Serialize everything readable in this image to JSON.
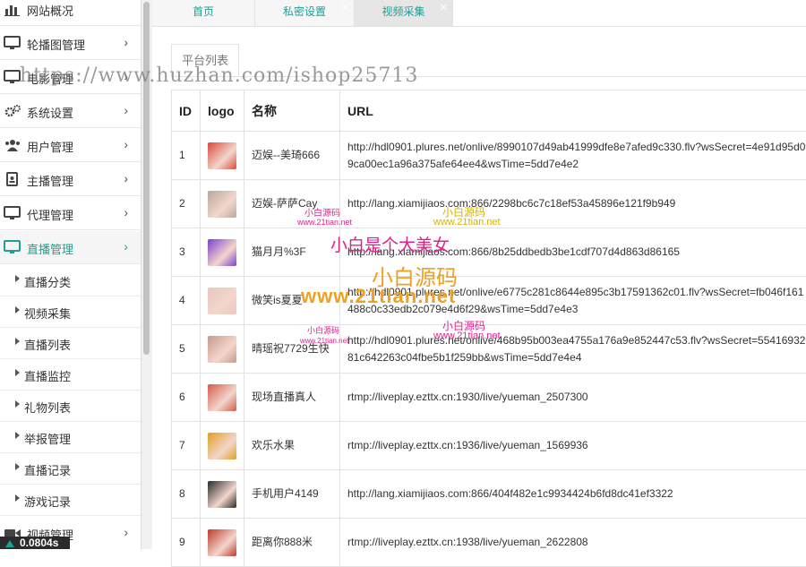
{
  "sidebar": {
    "items": [
      {
        "label": "网站概况",
        "icon": "bar-chart-icon",
        "chevron": false
      },
      {
        "label": "轮播图管理",
        "icon": "monitor-icon",
        "chevron": true
      },
      {
        "label": "电影管理",
        "icon": "monitor-icon",
        "chevron": true
      },
      {
        "label": "系统设置",
        "icon": "gears-icon",
        "chevron": true
      },
      {
        "label": "用户管理",
        "icon": "users-icon",
        "chevron": true
      },
      {
        "label": "主播管理",
        "icon": "id-card-icon",
        "chevron": true
      },
      {
        "label": "代理管理",
        "icon": "monitor-icon",
        "chevron": true
      },
      {
        "label": "直播管理",
        "icon": "monitor-icon",
        "chevron": true,
        "active": true
      }
    ],
    "sub_items": [
      "直播分类",
      "视频采集",
      "直播列表",
      "直播监控",
      "礼物列表",
      "举报管理",
      "直播记录",
      "游戏记录"
    ],
    "bottom_item": {
      "label": "视频管理",
      "icon": "video-camera-icon"
    },
    "chevron": "›",
    "status": "0.0804s",
    "accent": "#1aa094"
  },
  "tabs": [
    {
      "label": "首页",
      "closable": false
    },
    {
      "label": "私密设置",
      "closable": true
    },
    {
      "label": "视频采集",
      "closable": true,
      "active": true
    }
  ],
  "panel": {
    "title": "平台列表"
  },
  "table": {
    "columns": [
      "ID",
      "logo",
      "名称",
      "URL"
    ],
    "rows": [
      {
        "id": "1",
        "name": "迈娱--美琦666",
        "url": "http://hdl0901.plures.net/onlive/8990107d49ab41999dfe8e7afed9c330.flv?wsSecret=4e91d95d09ca00ec1a96a375afe64ee4&wsTime=5dd7e4e2",
        "thumb": "#d84a3c"
      },
      {
        "id": "2",
        "name": "迈娱-萨萨Cay",
        "url": "http://lang.xiamijiaos.com:866/2298bc6c7c18ef53a45896e121f9b949",
        "thumb": "#b9a89a"
      },
      {
        "id": "3",
        "name": "猫月月%3F",
        "url": "http://lang.xiamijiaos.com:866/8b25ddbedb3be1cdf707d4d863d86165",
        "thumb": "#7b3fd0"
      },
      {
        "id": "4",
        "name": "微笑is夏夏",
        "url": "http://hdl0901.plures.net/onlive/e6775c281c8644e895c3b17591362c01.flv?wsSecret=fb046f161488c0c33edb2c079e4d6f29&wsTime=5dd7e4e3",
        "thumb": "#e9c7c0"
      },
      {
        "id": "5",
        "name": "晴瑶祝7729生快",
        "url": "http://hdl0901.plures.net/onlive/468b95b003ea4755a176a9e852447c53.flv?wsSecret=5541693281c642263c04fbe5b1f259bb&wsTime=5dd7e4e4",
        "thumb": "#c89a8a"
      },
      {
        "id": "6",
        "name": "现场直播真人",
        "url": "rtmp://liveplay.ezttx.cn:1930/live/yueman_2507300",
        "thumb": "#d55a4a"
      },
      {
        "id": "7",
        "name": "欢乐水果",
        "url": "rtmp://liveplay.ezttx.cn:1936/live/yueman_1569936",
        "thumb": "#e0a020"
      },
      {
        "id": "8",
        "name": "手机用户4149",
        "url": "http://lang.xiamijiaos.com:866/404f482e1c9934424b6fd8dc41ef3322",
        "thumb": "#2a2a2a"
      },
      {
        "id": "9",
        "name": "距离你888米",
        "url": "rtmp://liveplay.ezttx.cn:1938/live/yueman_2622808",
        "thumb": "#c0392b"
      }
    ]
  },
  "watermarks": {
    "url_banner": "https://www.huzhan.com/ishop25713",
    "small_source": "小白源码",
    "small_domain": "www.21tian.net",
    "slogan": "小白是个大美女",
    "big_source": "小白源码",
    "big_domain": "www.21tian.net"
  }
}
